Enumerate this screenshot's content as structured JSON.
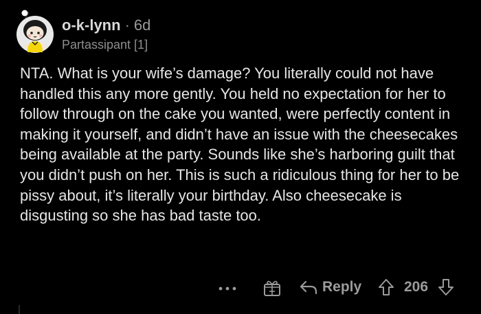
{
  "comment": {
    "author": "o-k-lynn",
    "separator": "·",
    "age": "6d",
    "flair": "Partassipant [1]",
    "body": "NTA. What is your wife’s damage? You literally could not have handled this any more gently. You held no expectation for her to follow through on the cake you wanted, were perfectly content in making it yourself, and didn’t have an issue with the cheesecakes being available at the party. Sounds like she’s harboring guilt that you didn’t push on her. This is such a ridiculous thing for her to be pissy about, it’s literally your birthday. Also cheesecake is disgusting so she has bad taste too.",
    "avatar_icon": "snoo-avatar-icon"
  },
  "actions": {
    "more_icon": "more-options-icon",
    "award_icon": "gift-award-icon",
    "reply_icon": "reply-arrow-icon",
    "reply_label": "Reply",
    "upvote_icon": "upvote-arrow-icon",
    "score": "206",
    "downvote_icon": "downvote-arrow-icon"
  },
  "colors": {
    "background": "#000000",
    "text": "#e6e6e6",
    "muted": "#9b9b9b",
    "avatar_bg": "#e9e9e9",
    "avatar_shirt": "#f5d60a"
  }
}
